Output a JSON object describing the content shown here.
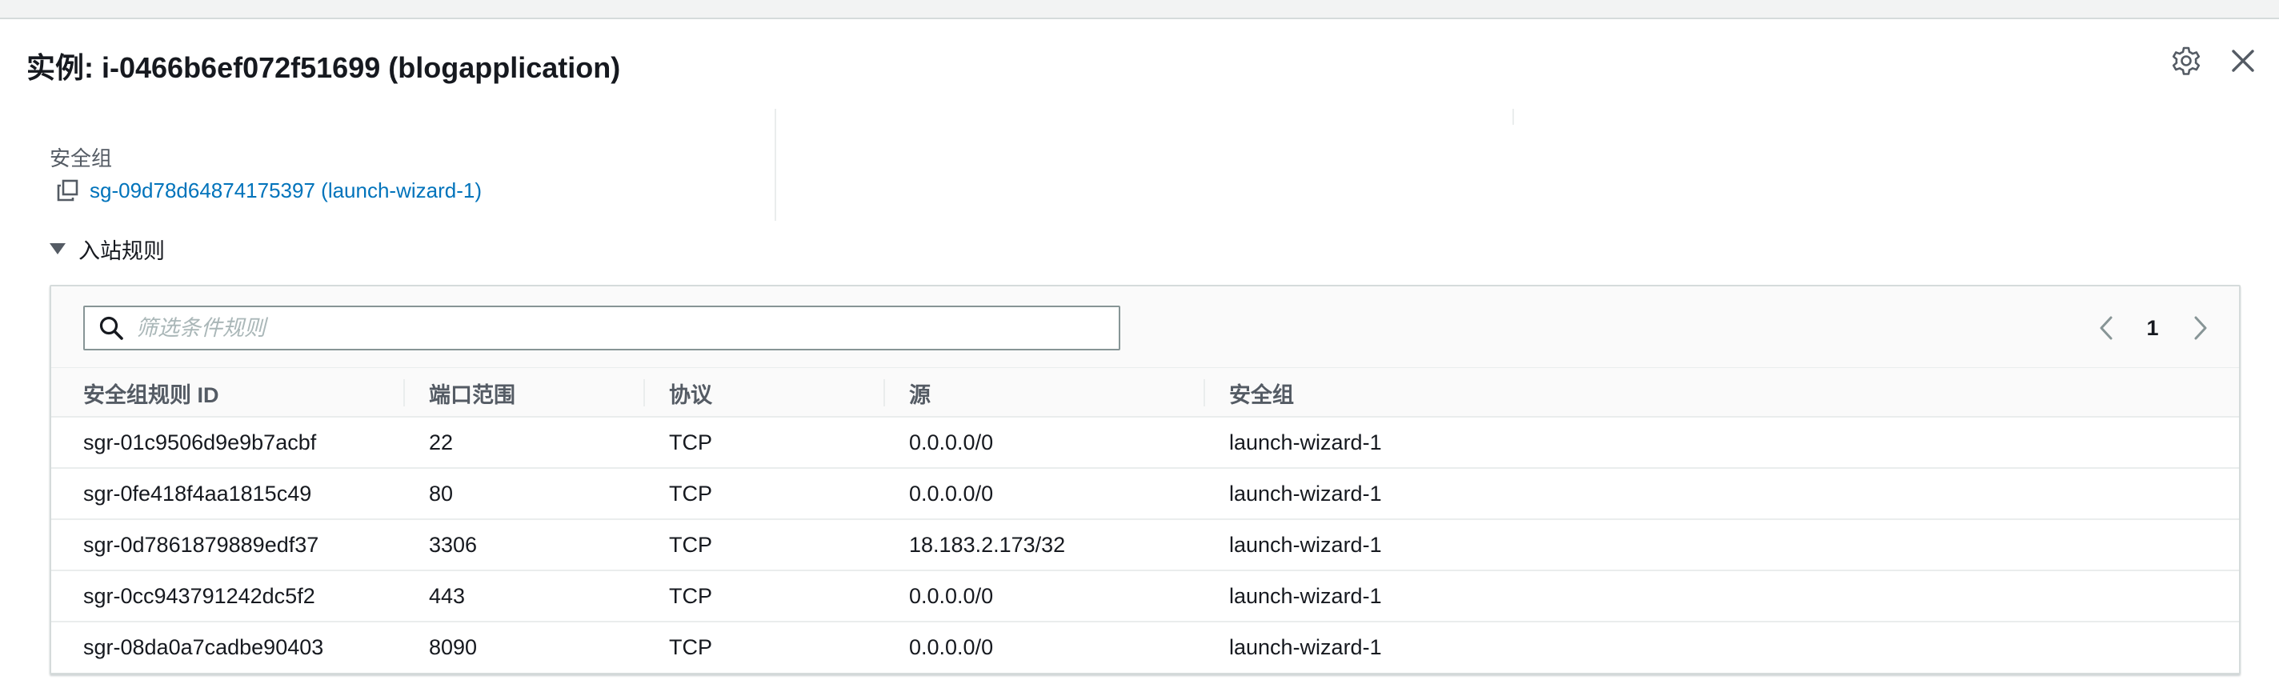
{
  "window": {
    "title": "实例: i-0466b6ef072f51699 (blogapplication)",
    "icons": {
      "settings": "gear-icon",
      "close": "close-icon",
      "drag": "drag-handle-icon"
    }
  },
  "security": {
    "label": "安全组",
    "group_link": "sg-09d78d64874175397 (launch-wizard-1)",
    "copy_icon": "copy-icon"
  },
  "inbound": {
    "section_label": "入站规则",
    "filter_placeholder": "筛选条件规则",
    "filter_value": "",
    "page": "1",
    "columns": [
      "安全组规则 ID",
      "端口范围",
      "协议",
      "源",
      "安全组"
    ],
    "rows": [
      [
        "sgr-01c9506d9e9b7acbf",
        "22",
        "TCP",
        "0.0.0.0/0",
        "launch-wizard-1"
      ],
      [
        "sgr-0fe418f4aa1815c49",
        "80",
        "TCP",
        "0.0.0.0/0",
        "launch-wizard-1"
      ],
      [
        "sgr-0d7861879889edf37",
        "3306",
        "TCP",
        "18.183.2.173/32",
        "launch-wizard-1"
      ],
      [
        "sgr-0cc943791242dc5f2",
        "443",
        "TCP",
        "0.0.0.0/0",
        "launch-wizard-1"
      ],
      [
        "sgr-08da0a7cadbe90403",
        "8090",
        "TCP",
        "0.0.0.0/0",
        "launch-wizard-1"
      ]
    ]
  },
  "colors": {
    "link": "#0073bb",
    "text": "#16191f",
    "muted": "#545b64",
    "border": "#d5dbdb"
  }
}
